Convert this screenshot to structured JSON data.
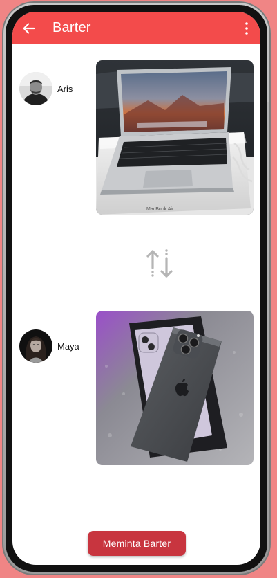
{
  "app_bar": {
    "title": "Barter",
    "back_icon": "arrow-left-icon",
    "menu_icon": "more-vertical-icon",
    "color": "#f34b4b"
  },
  "offer_from": {
    "user_name": "Aris",
    "avatar_icon": "avatar",
    "item_image": "laptop-photo",
    "item_caption": "MacBook Air"
  },
  "offer_to": {
    "user_name": "Maya",
    "avatar_icon": "avatar",
    "item_image": "smartphone-photo"
  },
  "swap_icon": "swap-vertical-icon",
  "action": {
    "label": "Meminta Barter",
    "color": "#c8353f"
  }
}
